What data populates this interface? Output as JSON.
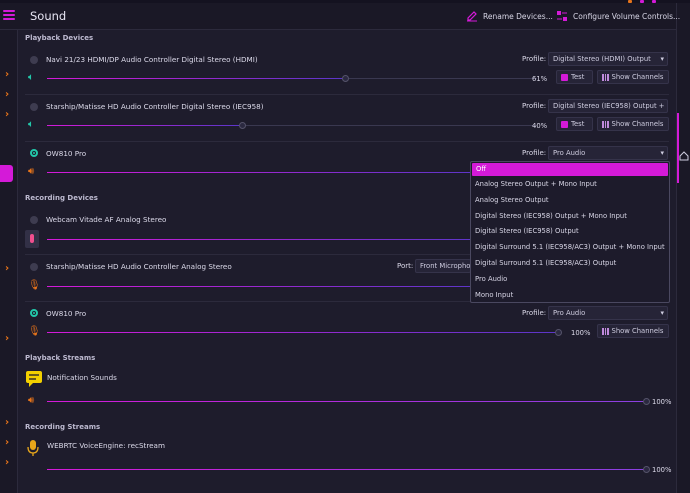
{
  "header": {
    "title": "Sound",
    "rename_label": "Rename Devices...",
    "configure_label": "Configure Volume Controls..."
  },
  "sections": {
    "playback_devices": "Playback Devices",
    "recording_devices": "Recording Devices",
    "playback_streams": "Playback Streams",
    "recording_streams": "Recording Streams"
  },
  "playback": [
    {
      "name": "Navi 21/23 HDMI/DP Audio Controller Digital Stereo (HDMI)",
      "profile_label": "Profile:",
      "profile": "Digital Stereo (HDMI) Output",
      "volume": 61,
      "volume_label": "61%",
      "test_label": "Test",
      "channels_label": "Show Channels"
    },
    {
      "name": "Starship/Matisse HD Audio Controller Digital Stereo (IEC958)",
      "profile_label": "Profile:",
      "profile": "Digital Stereo (IEC958) Output +",
      "volume": 40,
      "volume_label": "40%",
      "test_label": "Test",
      "channels_label": "Show Channels"
    },
    {
      "name": "OW810 Pro",
      "profile_label": "Profile:",
      "profile": "Pro Audio",
      "volume": 100
    }
  ],
  "recording": [
    {
      "name": "Webcam Vitade AF Analog Stereo",
      "volume": 100
    },
    {
      "name": "Starship/Matisse HD Audio Controller Analog Stereo",
      "port_label": "Port:",
      "port": "Front Microphone",
      "volume": 100
    },
    {
      "name": "OW810 Pro",
      "profile_label": "Profile:",
      "profile": "Pro Audio",
      "volume": 100,
      "volume_label": "100%",
      "channels_label": "Show Channels"
    }
  ],
  "streams": {
    "notification": {
      "name": "Notification Sounds",
      "volume": 100,
      "volume_label": "100%"
    },
    "webrtc": {
      "name": "WEBRTC VoiceEngine: recStream",
      "volume": 100,
      "volume_label": "100%"
    }
  },
  "dropdown": {
    "options": [
      "Off",
      "Analog Stereo Output + Mono Input",
      "Analog Stereo Output",
      "Digital Stereo (IEC958) Output + Mono Input",
      "Digital Stereo (IEC958) Output",
      "Digital Surround 5.1 (IEC958/AC3) Output + Mono Input",
      "Digital Surround 5.1 (IEC958/AC3) Output",
      "Pro Audio",
      "Mono Input"
    ],
    "selected": "Off"
  },
  "icons": {
    "speaker_on": "speaker-icon",
    "speaker_active": "speaker-active-icon",
    "mic": "microphone-icon",
    "notification": "notification-icon"
  },
  "colors": {
    "accent": "#d41ad8",
    "active_green": "#22c7a9",
    "warning_orange": "#e8741a"
  }
}
